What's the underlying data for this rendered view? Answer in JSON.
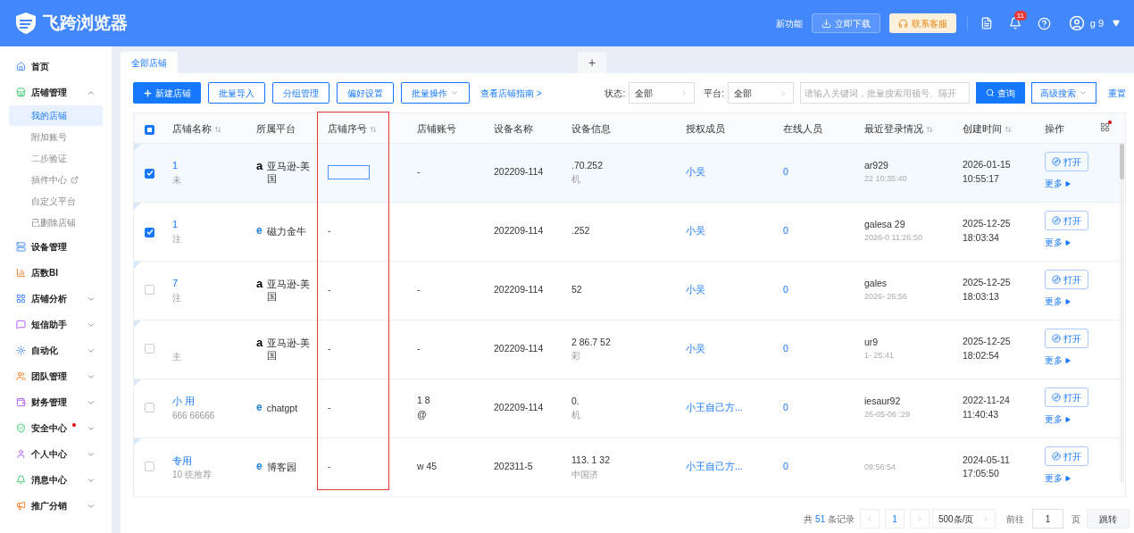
{
  "header": {
    "brand": "飞跨浏览器",
    "new_features": "新功能",
    "download": "立即下载",
    "support": "联系客服",
    "notification_count": "11",
    "user": "g 9"
  },
  "sidebar": {
    "items": [
      {
        "label": "首页",
        "kind": "link",
        "selected": false
      },
      {
        "label": "店铺管理",
        "kind": "group",
        "expanded": true,
        "selected": false,
        "children": [
          {
            "label": "我的店铺",
            "selected": true,
            "external": false
          },
          {
            "label": "附加账号",
            "selected": false,
            "external": false
          },
          {
            "label": "二步验证",
            "selected": false,
            "external": false
          },
          {
            "label": "插件中心",
            "selected": false,
            "external": true
          },
          {
            "label": "自定义平台",
            "selected": false,
            "external": false
          },
          {
            "label": "已删除店铺",
            "selected": false,
            "external": false
          }
        ]
      },
      {
        "label": "设备管理",
        "kind": "link",
        "selected": false
      },
      {
        "label": "店数BI",
        "kind": "link",
        "selected": false
      },
      {
        "label": "店铺分析",
        "kind": "group",
        "expanded": false,
        "selected": false
      },
      {
        "label": "短信助手",
        "kind": "group",
        "expanded": false,
        "selected": false
      },
      {
        "label": "自动化",
        "kind": "group",
        "expanded": false,
        "selected": false
      },
      {
        "label": "团队管理",
        "kind": "group",
        "expanded": false,
        "selected": false
      },
      {
        "label": "财务管理",
        "kind": "group",
        "expanded": false,
        "selected": false
      },
      {
        "label": "安全中心",
        "kind": "group",
        "expanded": false,
        "selected": false,
        "alert": true
      },
      {
        "label": "个人中心",
        "kind": "group",
        "expanded": false,
        "selected": false
      },
      {
        "label": "消息中心",
        "kind": "group",
        "expanded": false,
        "selected": false
      },
      {
        "label": "推广分销",
        "kind": "group",
        "expanded": false,
        "selected": false
      }
    ]
  },
  "tabs": [
    {
      "label": "全部店铺",
      "selected": true
    },
    {
      "label": "+",
      "selected": false
    }
  ],
  "toolbar": {
    "buttons": [
      {
        "label": "新建店铺",
        "kind": "primary"
      },
      {
        "label": "批量导入",
        "kind": "outline"
      },
      {
        "label": "分组管理",
        "kind": "outline"
      },
      {
        "label": "偏好设置",
        "kind": "outline"
      },
      {
        "label": "批量操作",
        "kind": "dropdown"
      }
    ],
    "guide_link": "查看店铺指南 >",
    "status_label": "状态:",
    "status_value": "全部",
    "platform_label": "平台:",
    "platform_value": "全部",
    "search_placeholder": "请输入关键词，批量搜索用顿号、隔开",
    "query": "查询",
    "advanced": "高级搜索",
    "reset": "重置"
  },
  "table": {
    "header_indeterminate": true,
    "columns": [
      {
        "label": "店铺名称",
        "sortable": true
      },
      {
        "label": "所属平台",
        "sortable": false
      },
      {
        "label": "店铺序号",
        "sortable": true
      },
      {
        "label": "店铺账号",
        "sortable": false
      },
      {
        "label": "设备名称",
        "sortable": false
      },
      {
        "label": "设备信息",
        "sortable": false
      },
      {
        "label": "授权成员",
        "sortable": false
      },
      {
        "label": "在线人员",
        "sortable": false
      },
      {
        "label": "最近登录情况",
        "sortable": true
      },
      {
        "label": "创建时间",
        "sortable": true
      },
      {
        "label": "操作",
        "sortable": false
      }
    ],
    "rows": [
      {
        "selected": true,
        "name": "1",
        "note": "未",
        "platform": {
          "kind": "amazon",
          "icon": "a",
          "name": "亚马逊-美国"
        },
        "sequence": {
          "kind": "editing"
        },
        "account": [
          "-"
        ],
        "device": "202209-114",
        "info": ".70.252",
        "info_sub": "机",
        "member": "小吴",
        "online": "0",
        "login": "ar929",
        "login_time": "22 10:35:40",
        "created_date": "2026-01-15",
        "created_time": "10:55:17",
        "open": "打开",
        "more": "更多"
      },
      {
        "selected": true,
        "name": "1",
        "note": "注",
        "platform": {
          "kind": "edge",
          "icon": "e",
          "name": "磁力金牛"
        },
        "sequence": {
          "kind": "text",
          "value": "-"
        },
        "device": "202209-114",
        "info": ".252",
        "member": "小吴",
        "online": "0",
        "login": "galesa 29",
        "login_time": "2026-0 11:26:50",
        "created_date": "2025-12-25",
        "created_time": "18:03:34",
        "open": "打开",
        "more": "更多"
      },
      {
        "selected": false,
        "name": "7",
        "note": "注",
        "platform": {
          "kind": "amazon",
          "icon": "a",
          "name": "亚马逊-美国"
        },
        "sequence": {
          "kind": "text",
          "value": "-"
        },
        "account": [
          "-"
        ],
        "device": "202209-114",
        "info": "52",
        "member": "小吴",
        "online": "0",
        "login": "gales",
        "login_time": "2026- 26:56",
        "created_date": "2025-12-25",
        "created_time": "18:03:13",
        "open": "打开",
        "more": "更多"
      },
      {
        "selected": false,
        "note": "主",
        "platform": {
          "kind": "amazon",
          "icon": "a",
          "name": "亚马逊-美国"
        },
        "sequence": {
          "kind": "text",
          "value": "-"
        },
        "account": [
          "-"
        ],
        "device": "202209-114",
        "info": "2 86.7 52",
        "info_sub": "彩",
        "member": "小吴",
        "online": "0",
        "login": "ur9",
        "login_time": "1- 25:41",
        "created_date": "2025-12-25",
        "created_time": "18:02:54",
        "open": "打开",
        "more": "更多"
      },
      {
        "selected": false,
        "name": "小 用",
        "note": "666 66666",
        "platform": {
          "kind": "edge",
          "icon": "e",
          "name": "chatgpt"
        },
        "sequence": {
          "kind": "text",
          "value": "-"
        },
        "account": [
          "1 8",
          "@"
        ],
        "device": "202209-114",
        "info": "0.",
        "info_sub": "机",
        "member": "小王自己方...",
        "online": "0",
        "login": "iesaur92",
        "login_time": "26-05-06 :29",
        "created_date": "2022-11-24",
        "created_time": "11:40:43",
        "open": "打开",
        "more": "更多"
      },
      {
        "selected": false,
        "name": "专用",
        "note": "10 统推荐",
        "platform": {
          "kind": "edge",
          "icon": "e",
          "name": "博客园"
        },
        "sequence": {
          "kind": "text",
          "value": "-"
        },
        "account": [
          "w 45"
        ],
        "device": "202311-5",
        "info": "113. 1 32",
        "info_sub": "中国济",
        "member": "小王自己方...",
        "online": "0",
        "login_time": "09:56:54",
        "created_date": "2024-05-11",
        "created_time": "17:05:50",
        "open": "打开",
        "more": "更多"
      }
    ]
  },
  "annotation": {
    "kind": "highlight-frame"
  },
  "pagination": {
    "total_prefix": "共",
    "total": "51",
    "total_suffix": "条记录",
    "pages": [
      {
        "label": "1",
        "selected": true
      }
    ],
    "page_size": "500条/页",
    "goto_label": "前往",
    "goto_value": "1",
    "page_unit": "页",
    "jump": "跳转"
  }
}
